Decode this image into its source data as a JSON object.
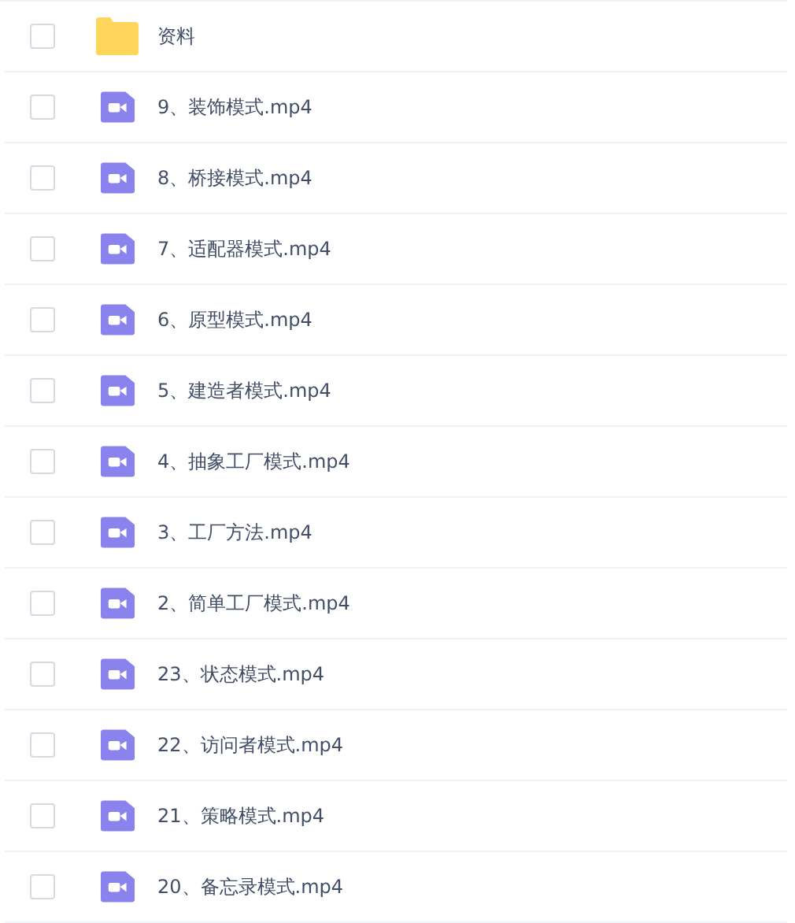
{
  "files": [
    {
      "kind": "folder",
      "name": "资料",
      "checked": false
    },
    {
      "kind": "video",
      "name": "9、装饰模式.mp4",
      "checked": false
    },
    {
      "kind": "video",
      "name": "8、桥接模式.mp4",
      "checked": false
    },
    {
      "kind": "video",
      "name": "7、适配器模式.mp4",
      "checked": false
    },
    {
      "kind": "video",
      "name": "6、原型模式.mp4",
      "checked": false
    },
    {
      "kind": "video",
      "name": "5、建造者模式.mp4",
      "checked": false
    },
    {
      "kind": "video",
      "name": "4、抽象工厂模式.mp4",
      "checked": false
    },
    {
      "kind": "video",
      "name": "3、工厂方法.mp4",
      "checked": false
    },
    {
      "kind": "video",
      "name": "2、简单工厂模式.mp4",
      "checked": false
    },
    {
      "kind": "video",
      "name": "23、状态模式.mp4",
      "checked": false
    },
    {
      "kind": "video",
      "name": "22、访问者模式.mp4",
      "checked": false
    },
    {
      "kind": "video",
      "name": "21、策略模式.mp4",
      "checked": false
    },
    {
      "kind": "video",
      "name": "20、备忘录模式.mp4",
      "checked": false
    }
  ]
}
